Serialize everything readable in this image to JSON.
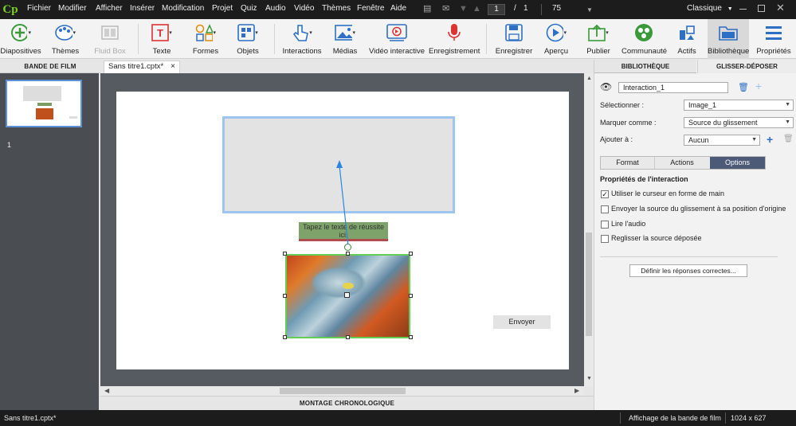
{
  "app": {
    "logo": "Cp"
  },
  "menu": [
    "Fichier",
    "Modifier",
    "Afficher",
    "Insérer",
    "Modification",
    "Projet",
    "Quiz",
    "Audio",
    "Vidéo",
    "Thèmes",
    "Fenêtre",
    "Aide"
  ],
  "nav": {
    "current_page": "1",
    "separator": "/",
    "total_pages": "1",
    "zoom": "75"
  },
  "mode": "Classique",
  "toolbar": {
    "slides": "Diapositives",
    "themes": "Thèmes",
    "fluidbox": "Fluid Box",
    "text": "Texte",
    "shapes": "Formes",
    "objects": "Objets",
    "interactions": "Interactions",
    "media": "Médias",
    "interactive_video": "Vidéo interactive",
    "record": "Enregistrement",
    "save": "Enregistrer",
    "preview": "Aperçu",
    "publish": "Publier",
    "community": "Communauté",
    "assets": "Actifs",
    "library": "Bibliothèque",
    "properties": "Propriétés"
  },
  "filmstrip": {
    "title": "BANDE DE FILM",
    "slide_number": "1"
  },
  "document": {
    "tab": "Sans titre1.cptx*",
    "close": "×"
  },
  "slide": {
    "success_text": "Tapez le texte de réussite ici.",
    "submit_button": "Envoyer"
  },
  "timeline": {
    "title": "MONTAGE CHRONOLOGIQUE"
  },
  "right_panel": {
    "tabs": [
      "BIBLIOTHÈQUE",
      "GLISSER-DÉPOSER"
    ],
    "interaction_name": "Interaction_1",
    "select_label": "Sélectionner :",
    "select_value": "Image_1",
    "mark_label": "Marquer comme :",
    "mark_value": "Source du glissement",
    "add_label": "Ajouter à :",
    "add_value": "Aucun",
    "subtabs": [
      "Format",
      "Actions",
      "Options"
    ],
    "section_title": "Propriétés de l'interaction",
    "options": [
      {
        "label": "Utiliser le curseur en forme de main",
        "checked": true
      },
      {
        "label": "Envoyer la source du glissement à sa position d'origine",
        "checked": false
      },
      {
        "label": "Lire l'audio",
        "checked": false
      },
      {
        "label": "Reglisser la source déposée",
        "checked": false
      }
    ],
    "define_button": "Définir les réponses correctes..."
  },
  "status": {
    "file": "Sans titre1.cptx*",
    "view": "Affichage de la bande de film",
    "resolution": "1024 x 627"
  },
  "colors": {
    "accent": "#2c7be5",
    "menubar_bg": "#1c1c1c",
    "filmstrip_bg": "#4a4d52",
    "canvas_bg": "#565b61",
    "selected_tab": "#4d5a77"
  }
}
